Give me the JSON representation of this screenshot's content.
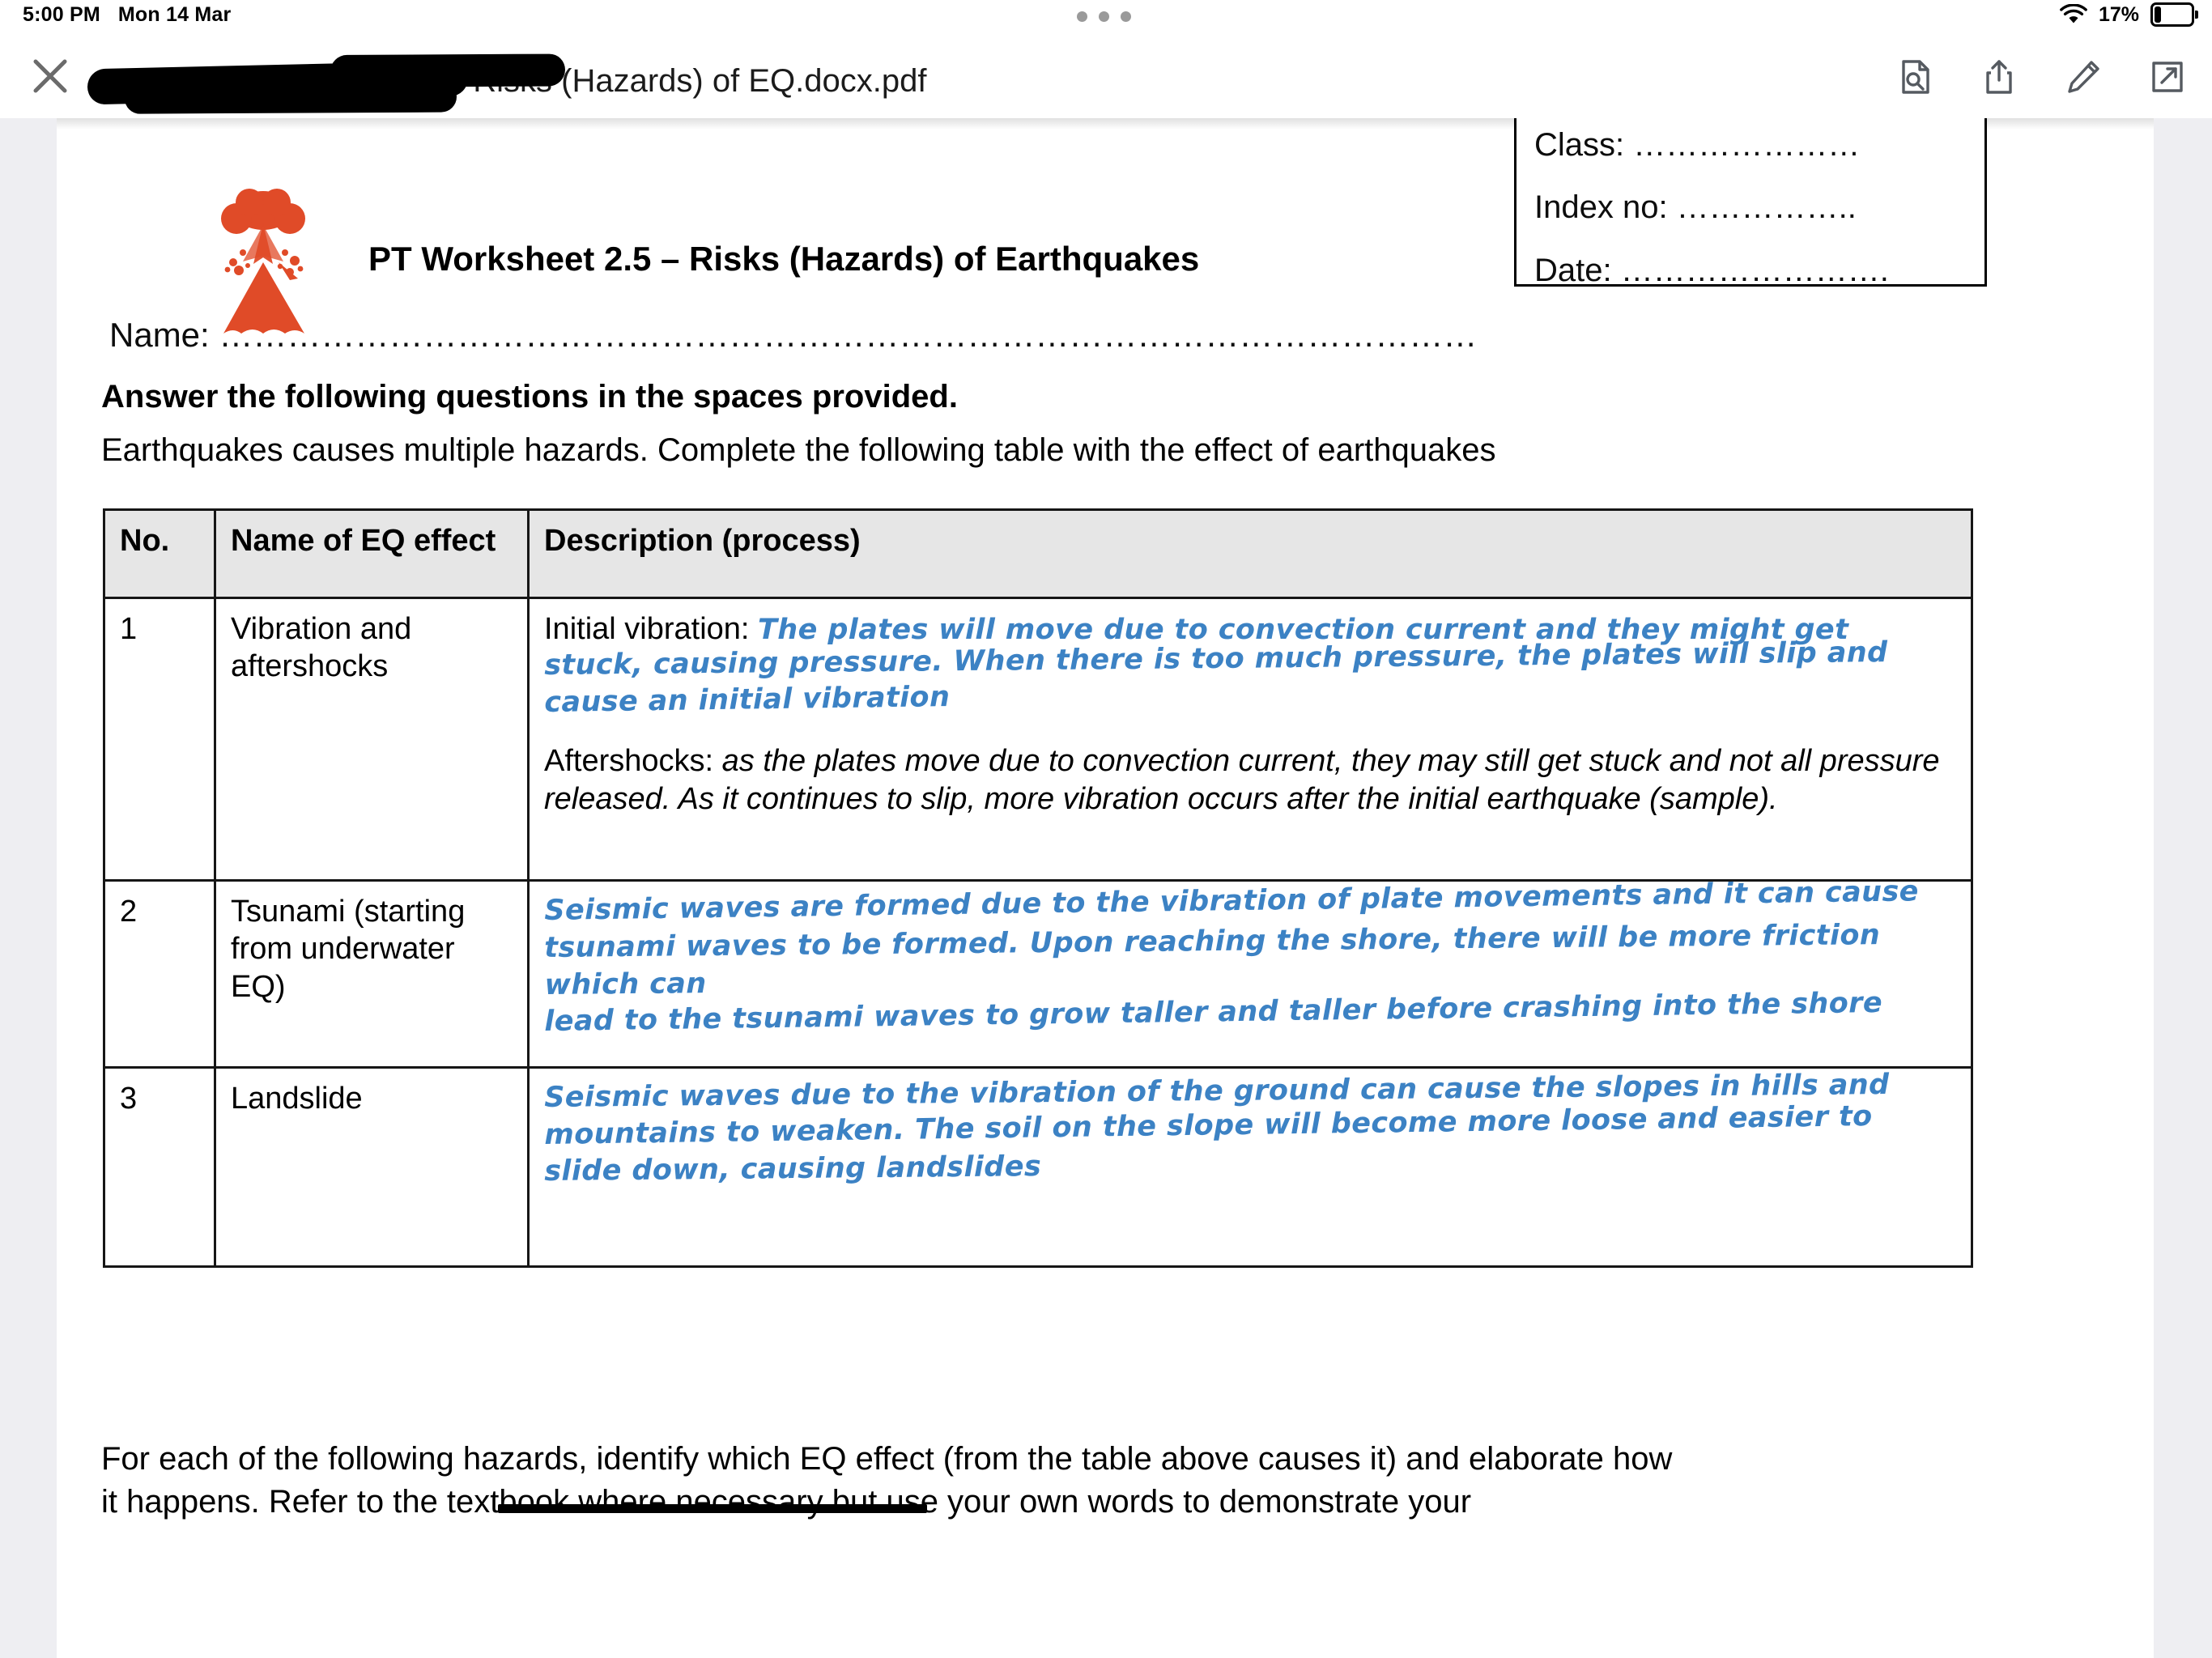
{
  "statusbar": {
    "time": "5:00 PM",
    "date": "Mon 14 Mar",
    "battery_percent": "17%",
    "wifi_icon": "wifi-icon",
    "battery_icon": "battery-icon",
    "multitask_icon": "multitask-handle-icon"
  },
  "toolbar": {
    "close_icon": "close-icon",
    "document_title": "ass) - PT Worksheet 2.5 – Risks (Hazards) of EQ.docx.pdf",
    "icons": [
      {
        "name": "document-search-icon",
        "label": "Search Document"
      },
      {
        "name": "share-icon",
        "label": "Share"
      },
      {
        "name": "markup-pencil-icon",
        "label": "Markup"
      },
      {
        "name": "open-in-new-icon",
        "label": "Open in New Window"
      }
    ]
  },
  "document": {
    "logo_icon": "volcano-icon",
    "logo_color": "#e04b28",
    "title": "PT Worksheet 2.5 – Risks (Hazards) of Earthquakes",
    "info_box": {
      "class_label": "Class: …………………",
      "index_label": "Index no: ……………..",
      "date_label": "Date: ……………………."
    },
    "name_line": "Name: …………………………………………………………………………………………………",
    "instruction": "Answer the following questions in the spaces provided.",
    "lead_in": "Earthquakes causes multiple hazards. Complete the following table with the effect of earthquakes",
    "table": {
      "headers": [
        "No.",
        "Name of EQ effect",
        "Description (process)"
      ],
      "rows": [
        {
          "no": "1",
          "name": "Vibration and aftershocks",
          "desc_label": "Initial vibration:",
          "handwriting": [
            "The plates will move due to convection current and they might get",
            "stuck, causing pressure. When there is too much pressure, the plates will slip and",
            "cause an initial vibration"
          ],
          "aftershocks_label": "Aftershocks:",
          "aftershocks_text": " as the plates move due to convection current, they may still get stuck and not all pressure released. As it continues to slip, more vibration occurs after the initial earthquake (sample)."
        },
        {
          "no": "2",
          "name": "Tsunami (starting from underwater EQ)",
          "handwriting": [
            "Seismic waves are formed due to the vibration of plate movements and it can cause",
            "tsunami waves to be formed. Upon reaching the shore, there will be more friction which can",
            "lead to the tsunami waves to grow taller and taller before crashing into the shore"
          ]
        },
        {
          "no": "3",
          "name": "Landslide",
          "handwriting": [
            "Seismic waves due to the vibration of the ground can cause the slopes in hills and",
            "mountains to weaken. The soil on the slope will become more loose and easier to",
            "slide down, causing landslides"
          ]
        }
      ]
    },
    "closing_line1": "For each of the following hazards, identify which EQ effect (from the table above causes it) and elaborate how",
    "closing_line2": "it happens. Refer to the textbook where necessary but use your own words to demonstrate your"
  }
}
